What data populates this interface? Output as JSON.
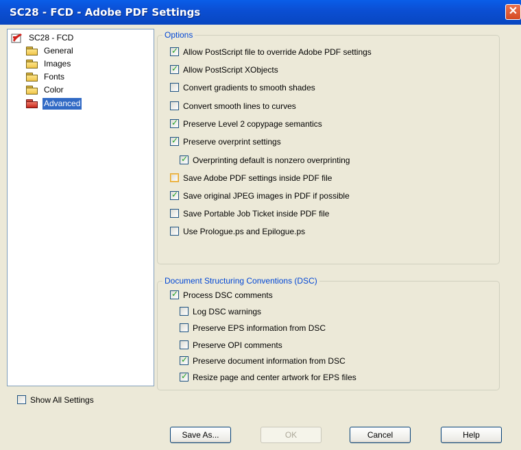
{
  "window": {
    "title": "SC28 - FCD - Adobe PDF Settings",
    "close_glyph": "✕"
  },
  "tree": {
    "root": {
      "label": "SC28 - FCD",
      "icon": "pdf-settings-icon"
    },
    "items": [
      {
        "label": "General",
        "icon": "folder-icon"
      },
      {
        "label": "Images",
        "icon": "folder-icon"
      },
      {
        "label": "Fonts",
        "icon": "folder-icon"
      },
      {
        "label": "Color",
        "icon": "folder-icon"
      },
      {
        "label": "Advanced",
        "icon": "folder-open-icon",
        "selected": true
      }
    ]
  },
  "options": {
    "label": "Options",
    "items": [
      {
        "label": "Allow PostScript file to override Adobe PDF settings",
        "checked": true
      },
      {
        "label": "Allow PostScript XObjects",
        "checked": true
      },
      {
        "label": "Convert gradients to smooth shades",
        "checked": false
      },
      {
        "label": "Convert smooth lines to curves",
        "checked": false
      },
      {
        "label": "Preserve Level 2 copypage semantics",
        "checked": true
      },
      {
        "label": "Preserve overprint settings",
        "checked": true
      },
      {
        "label": "Overprinting default is nonzero overprinting",
        "checked": true
      },
      {
        "label": "Save Adobe PDF settings inside PDF file",
        "checked": false,
        "focused": true
      },
      {
        "label": "Save original JPEG images in PDF if possible",
        "checked": true
      },
      {
        "label": "Save Portable Job Ticket inside PDF file",
        "checked": false
      },
      {
        "label": "Use Prologue.ps and Epilogue.ps",
        "checked": false
      }
    ]
  },
  "dsc": {
    "label": "Document Structuring Conventions (DSC)",
    "items": [
      {
        "label": "Process DSC comments",
        "checked": true
      },
      {
        "label": "Log DSC warnings",
        "checked": false
      },
      {
        "label": "Preserve EPS information from DSC",
        "checked": false
      },
      {
        "label": "Preserve OPI comments",
        "checked": false
      },
      {
        "label": "Preserve document information from DSC",
        "checked": true
      },
      {
        "label": "Resize page and center artwork for EPS files",
        "checked": true
      }
    ]
  },
  "show_all": {
    "label": "Show All Settings",
    "checked": false
  },
  "buttons": {
    "save_as": "Save As...",
    "ok": "OK",
    "cancel": "Cancel",
    "help": "Help"
  },
  "check_glyph": "✓",
  "colors": {
    "title_bar": "#0b4fd4",
    "selection": "#316ac5",
    "group_label": "#0046d5",
    "check": "#21a121"
  }
}
